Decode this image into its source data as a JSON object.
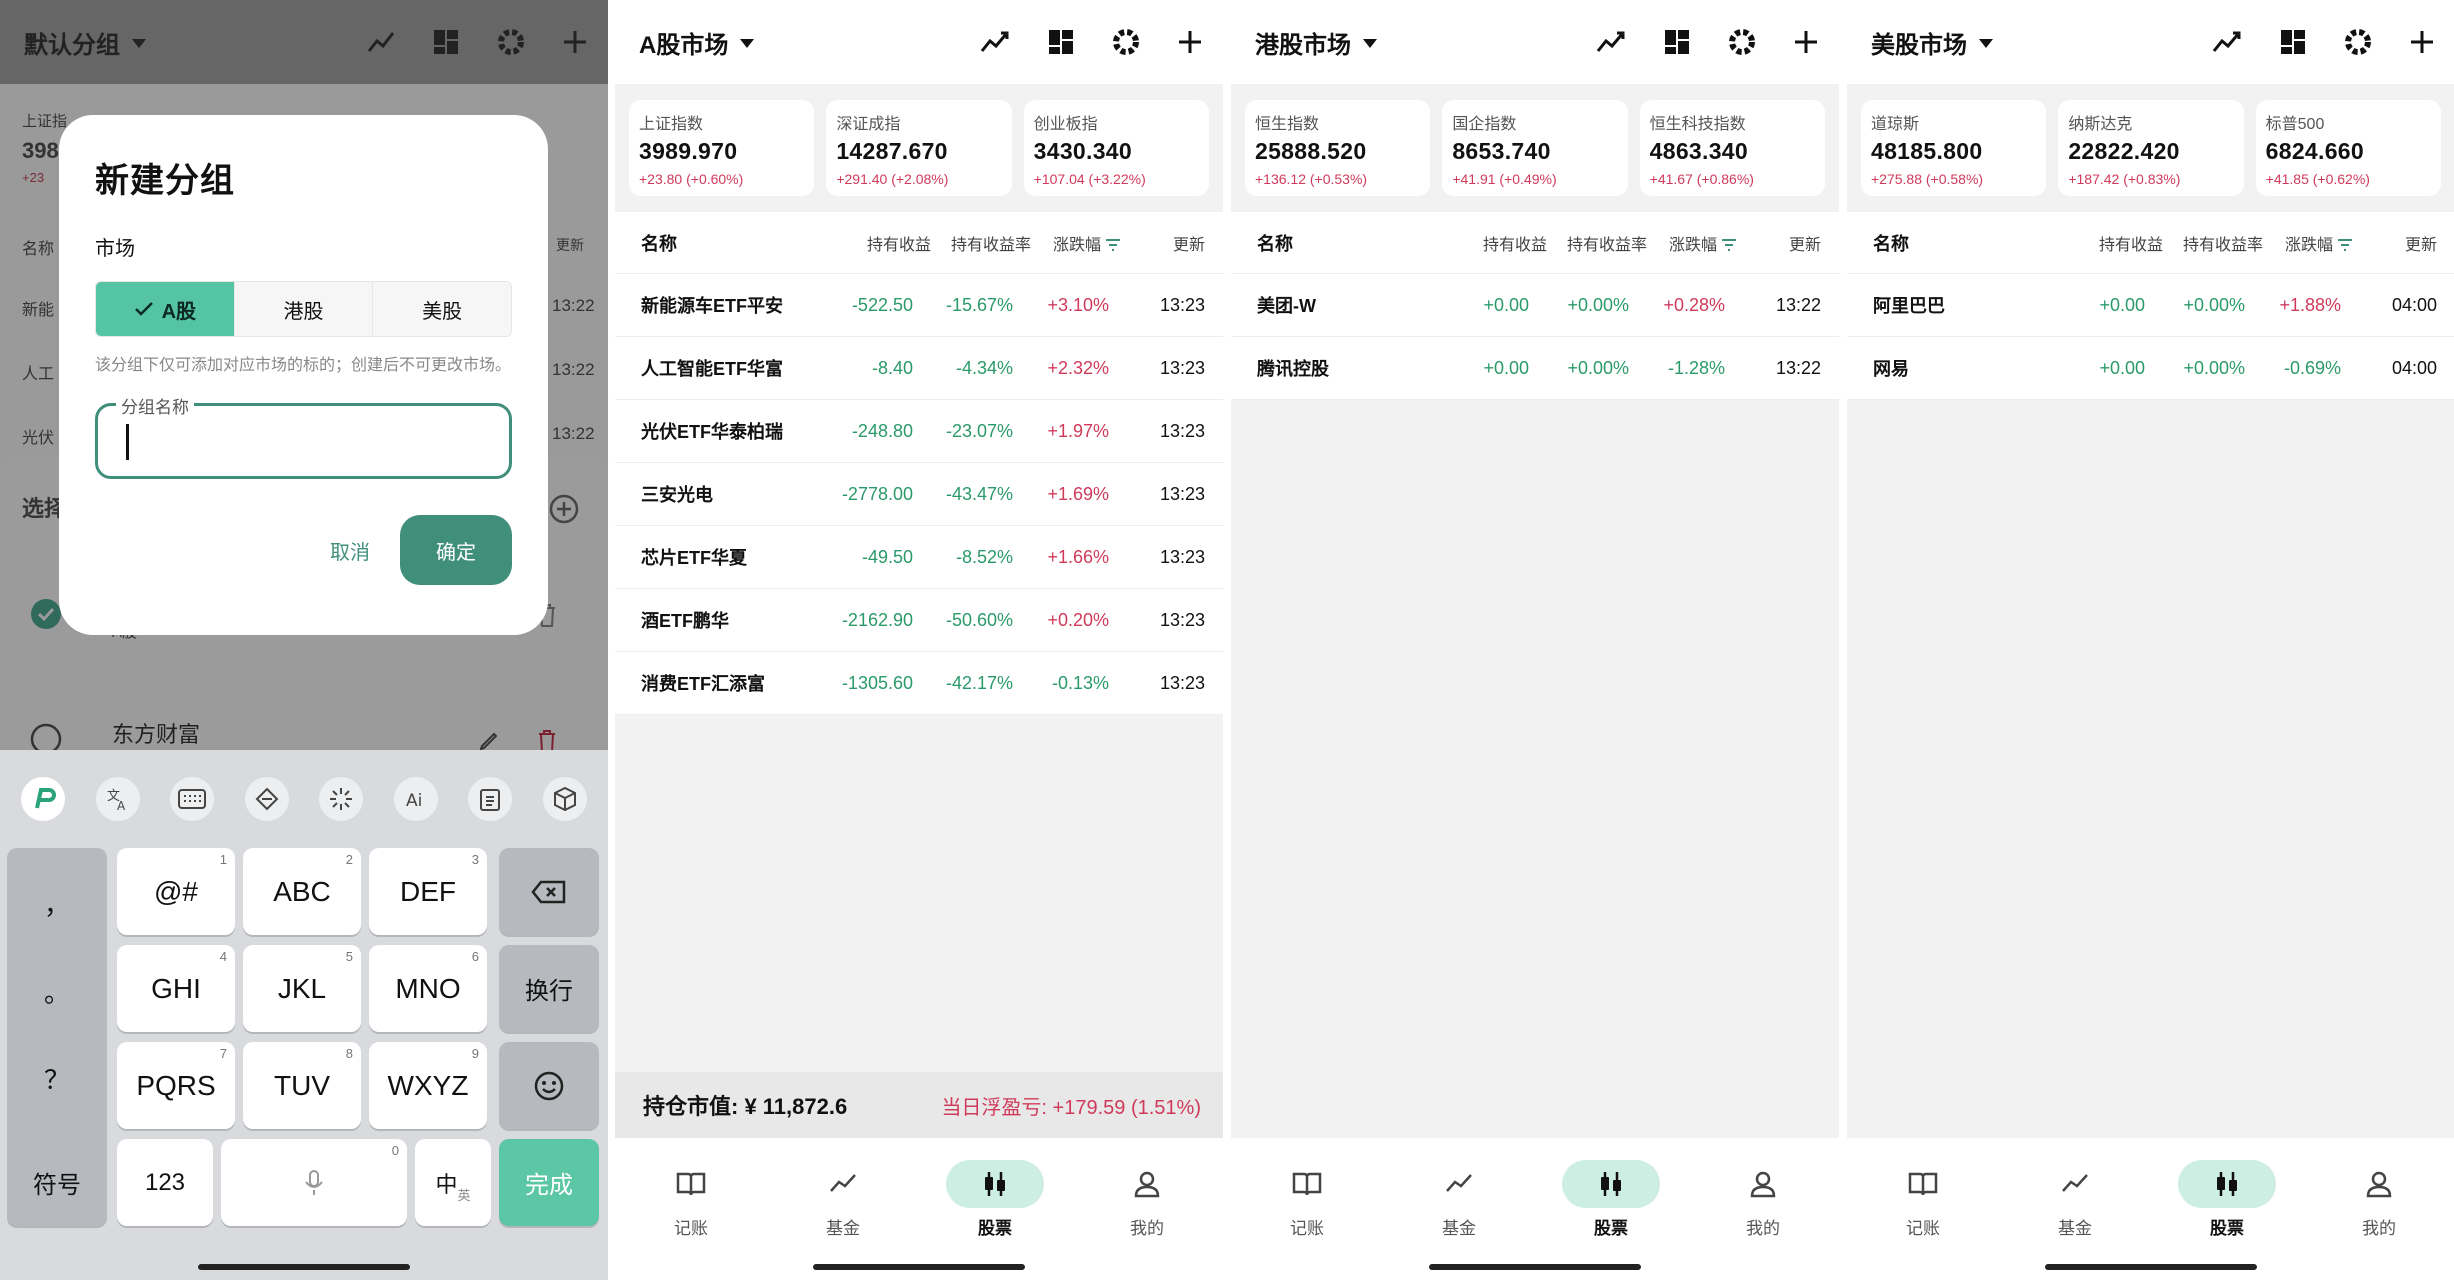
{
  "left": {
    "header_title": "默认分组",
    "bg_sidebar": [
      "上证指",
      "398",
      "+23",
      "名称",
      "新能",
      "人工",
      "光伏"
    ],
    "bg_times": [
      "更新",
      "13:22",
      "13:22",
      "13:22"
    ],
    "sheet_title": "选择",
    "sheet_item_sub": "A股",
    "sheet_item2": "东方财富",
    "dialog": {
      "title": "新建分组",
      "market_label": "市场",
      "segments": [
        "A股",
        "港股",
        "美股"
      ],
      "selected": "A股",
      "hint": "该分组下仅可添加对应市场的标的；创建后不可更改市场。",
      "field_label": "分组名称",
      "field_value": "",
      "cancel": "取消",
      "confirm": "确定"
    },
    "keyboard": {
      "left_col": [
        "，",
        "。",
        "？",
        "！"
      ],
      "rows": [
        [
          {
            "k": "@#",
            "n": "1"
          },
          {
            "k": "ABC",
            "n": "2"
          },
          {
            "k": "DEF",
            "n": "3"
          }
        ],
        [
          {
            "k": "GHI",
            "n": "4"
          },
          {
            "k": "JKL",
            "n": "5"
          },
          {
            "k": "MNO",
            "n": "6"
          }
        ],
        [
          {
            "k": "PQRS",
            "n": "7"
          },
          {
            "k": "TUV",
            "n": "8"
          },
          {
            "k": "WXYZ",
            "n": "9"
          }
        ]
      ],
      "newline": "换行",
      "symbols": "符号",
      "num": "123",
      "space_num": "0",
      "lang": "中",
      "lang_sub": "英",
      "done": "完成"
    }
  },
  "nav": [
    "记账",
    "基金",
    "股票",
    "我的"
  ],
  "panels": [
    {
      "market": "A股市场",
      "indices": [
        {
          "name": "上证指数",
          "value": "3989.970",
          "change": "+23.80 (+0.60%)"
        },
        {
          "name": "深证成指",
          "value": "14287.670",
          "change": "+291.40 (+2.08%)"
        },
        {
          "name": "创业板指",
          "value": "3430.340",
          "change": "+107.04 (+3.22%)"
        }
      ],
      "columns": [
        "名称",
        "持有收益",
        "持有收益率",
        "涨跌幅",
        "更新"
      ],
      "rows": [
        {
          "name": "新能源车ETF平安",
          "gain": "-522.50",
          "rate": "-15.67%",
          "chg": "+3.10%",
          "time": "13:23"
        },
        {
          "name": "人工智能ETF华富",
          "gain": "-8.40",
          "rate": "-4.34%",
          "chg": "+2.32%",
          "time": "13:23"
        },
        {
          "name": "光伏ETF华泰柏瑞",
          "gain": "-248.80",
          "rate": "-23.07%",
          "chg": "+1.97%",
          "time": "13:23"
        },
        {
          "name": "三安光电",
          "gain": "-2778.00",
          "rate": "-43.47%",
          "chg": "+1.69%",
          "time": "13:23"
        },
        {
          "name": "芯片ETF华夏",
          "gain": "-49.50",
          "rate": "-8.52%",
          "chg": "+1.66%",
          "time": "13:23"
        },
        {
          "name": "酒ETF鹏华",
          "gain": "-2162.90",
          "rate": "-50.60%",
          "chg": "+0.20%",
          "time": "13:23"
        },
        {
          "name": "消费ETF汇添富",
          "gain": "-1305.60",
          "rate": "-42.17%",
          "chg": "-0.13%",
          "time": "13:23"
        }
      ],
      "footer_left": "持仓市值: ¥ 11,872.6",
      "footer_right": "当日浮盈亏: +179.59 (1.51%)"
    },
    {
      "market": "港股市场",
      "indices": [
        {
          "name": "恒生指数",
          "value": "25888.520",
          "change": "+136.12 (+0.53%)"
        },
        {
          "name": "国企指数",
          "value": "8653.740",
          "change": "+41.91 (+0.49%)"
        },
        {
          "name": "恒生科技指数",
          "value": "4863.340",
          "change": "+41.67 (+0.86%)"
        }
      ],
      "columns": [
        "名称",
        "持有收益",
        "持有收益率",
        "涨跌幅",
        "更新"
      ],
      "rows": [
        {
          "name": "美团-W",
          "gain": "+0.00",
          "rate": "+0.00%",
          "chg": "+0.28%",
          "time": "13:22"
        },
        {
          "name": "腾讯控股",
          "gain": "+0.00",
          "rate": "+0.00%",
          "chg": "-1.28%",
          "time": "13:22"
        }
      ]
    },
    {
      "market": "美股市场",
      "indices": [
        {
          "name": "道琼斯",
          "value": "48185.800",
          "change": "+275.88 (+0.58%)"
        },
        {
          "name": "纳斯达克",
          "value": "22822.420",
          "change": "+187.42 (+0.83%)"
        },
        {
          "name": "标普500",
          "value": "6824.660",
          "change": "+41.85 (+0.62%)"
        }
      ],
      "columns": [
        "名称",
        "持有收益",
        "持有收益率",
        "涨跌幅",
        "更新"
      ],
      "rows": [
        {
          "name": "阿里巴巴",
          "gain": "+0.00",
          "rate": "+0.00%",
          "chg": "+1.88%",
          "time": "04:00"
        },
        {
          "name": "网易",
          "gain": "+0.00",
          "rate": "+0.00%",
          "chg": "-0.69%",
          "time": "04:00"
        }
      ]
    }
  ],
  "colors": {
    "accent": "#3f8f7a",
    "up": "#d03a5a",
    "down": "#2a9a6a",
    "seg_active": "#54c4a5"
  }
}
